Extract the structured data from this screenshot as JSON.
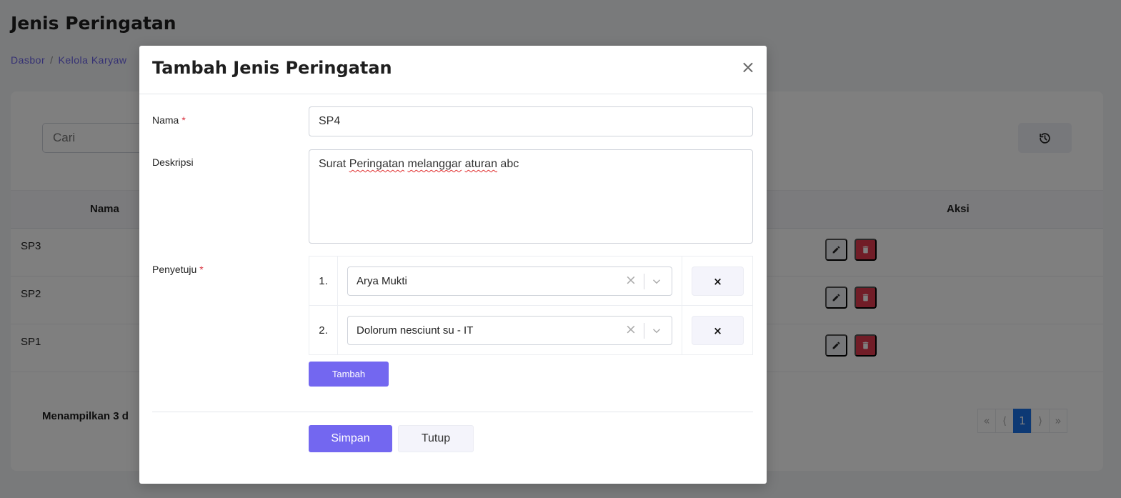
{
  "page": {
    "title": "Jenis Peringatan",
    "breadcrumb": [
      "Dasbor",
      "Kelola Karyaw"
    ]
  },
  "search": {
    "placeholder": "Cari"
  },
  "table": {
    "headers": {
      "nama": "Nama",
      "aksi": "Aksi"
    },
    "rows": [
      {
        "name": "SP3"
      },
      {
        "name": "SP2"
      },
      {
        "name": "SP1"
      }
    ]
  },
  "footer": {
    "showing_text": "Menampilkan 3 d",
    "pagination": {
      "first": "«",
      "prev": "⟨",
      "current": "1",
      "next": "⟩",
      "last": "»"
    }
  },
  "modal": {
    "title": "Tambah Jenis Peringatan",
    "close_label": "×",
    "fields": {
      "nama": {
        "label": "Nama",
        "required": "*",
        "value": "SP4"
      },
      "deskripsi": {
        "label": "Deskripsi",
        "value_prefix": "Surat ",
        "value_misspelled_1": "Peringatan",
        "value_middle": " ",
        "value_misspelled_2": "melanggar",
        "value_middle_2": " ",
        "value_misspelled_3": "aturan",
        "value_suffix": " abc"
      },
      "penyetuju": {
        "label": "Penyetuju",
        "required": "*",
        "items": [
          {
            "number": "1.",
            "value": "Arya Mukti",
            "clear": "×",
            "remove": "×"
          },
          {
            "number": "2.",
            "value": "Dolorum nesciunt su - IT",
            "clear": "×",
            "remove": "×"
          }
        ]
      }
    },
    "buttons": {
      "tambah": "Tambah",
      "simpan": "Simpan",
      "tutup": "Tutup"
    }
  },
  "colors": {
    "primary": "#7367f0",
    "danger": "#e23a4e",
    "page_active": "#1b72e8",
    "breadcrumb": "#6b63e8"
  }
}
